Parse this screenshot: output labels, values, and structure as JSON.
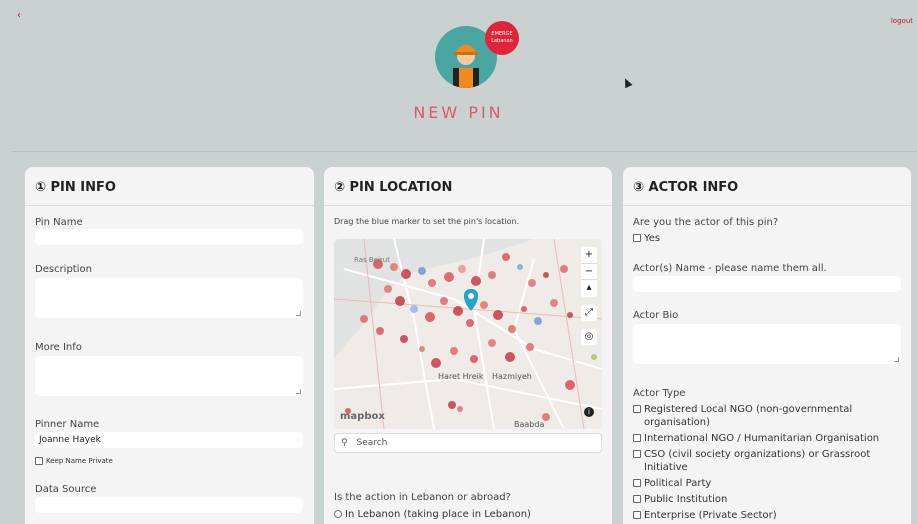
{
  "header": {
    "back_glyph": "‹",
    "logout": "logout",
    "badge_text": "EMERGE",
    "badge_sub": "Lebanon",
    "page_title": "NEW PIN"
  },
  "panels": {
    "pin_info": {
      "title": "① PIN INFO",
      "pin_name_label": "Pin Name",
      "pin_name_value": "",
      "description_label": "Description",
      "more_info_label": "More Info",
      "pinner_name_label": "Pinner Name",
      "pinner_name_value": "Joanne Hayek",
      "keep_private_label": "Keep Name Private",
      "data_source_label": "Data Source"
    },
    "pin_location": {
      "title": "② PIN LOCATION",
      "instruction": "Drag the blue marker to set the pin's location.",
      "map_labels": {
        "top_left": "Ras Beirut",
        "mid": "Haret Hreik",
        "mid2": "Hazmiyeh",
        "bottom": "Baabda",
        "logo": "mapbox"
      },
      "search_placeholder": "Search",
      "action_question": "Is the action in Lebanon or abroad?",
      "option_lebanon": "In Lebanon (taking place in Lebanon)"
    },
    "actor_info": {
      "title": "③ ACTOR INFO",
      "are_you_actor": "Are you the actor of this pin?",
      "yes_label": "Yes",
      "actors_name_label": "Actor(s) Name - please name them all.",
      "actor_bio_label": "Actor Bio",
      "actor_type_label": "Actor Type",
      "actor_types": [
        "Registered Local NGO (non-governmental organisation)",
        "International NGO / Humanitarian Organisation",
        "CSO (civil society organizations) or Grassroot Initiative",
        "Political Party",
        "Public Institution",
        "Enterprise (Private Sector)"
      ]
    }
  },
  "colors": {
    "accent": "#e0586b",
    "badge": "#e0253a",
    "avatar_bg": "#49a6a2",
    "marker": "#2aa3c8"
  }
}
